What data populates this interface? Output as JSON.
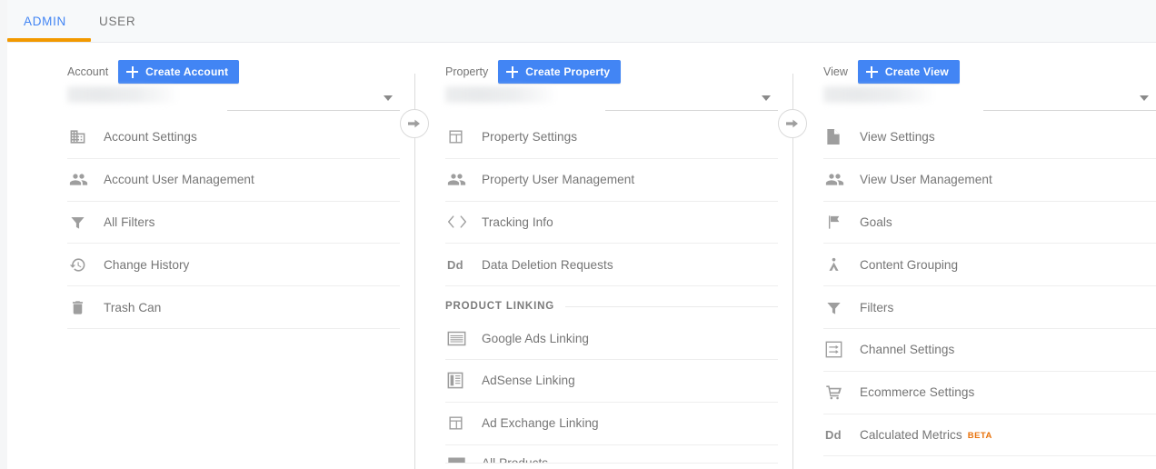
{
  "tabs": [
    {
      "label": "ADMIN",
      "active": true
    },
    {
      "label": "USER",
      "active": false
    }
  ],
  "colors": {
    "accent_blue": "#4285f4",
    "tab_underline_orange": "#f29900",
    "beta_badge_orange": "#e8710a",
    "text_gray": "#757575",
    "icon_gray": "#9e9e9e",
    "divider_gray": "#eeeeee",
    "header_bg": "#f7f9fa"
  },
  "columns": {
    "account": {
      "label": "Account",
      "create_button": "Create Account",
      "selector_value": "",
      "selector_caret": "chevron-down-icon",
      "items": [
        {
          "label": "Account Settings",
          "icon": "building-icon"
        },
        {
          "label": "Account User Management",
          "icon": "people-icon"
        },
        {
          "label": "All Filters",
          "icon": "funnel-icon"
        },
        {
          "label": "Change History",
          "icon": "history-icon"
        },
        {
          "label": "Trash Can",
          "icon": "trash-icon"
        }
      ]
    },
    "property": {
      "label": "Property",
      "create_button": "Create Property",
      "selector_value": "",
      "selector_caret": "chevron-down-icon",
      "items": [
        {
          "label": "Property Settings",
          "icon": "layout-icon"
        },
        {
          "label": "Property User Management",
          "icon": "people-icon"
        },
        {
          "label": "Tracking Info",
          "icon": "code-brackets-icon"
        },
        {
          "label": "Data Deletion Requests",
          "icon": "dd-text-icon"
        }
      ],
      "section": {
        "title": "PRODUCT LINKING"
      },
      "section_items": [
        {
          "label": "Google Ads Linking",
          "icon": "ad-banner-icon"
        },
        {
          "label": "AdSense Linking",
          "icon": "adsense-icon"
        },
        {
          "label": "Ad Exchange Linking",
          "icon": "layout-icon"
        },
        {
          "label": "All Products",
          "icon": "products-icon",
          "clipped": true
        }
      ]
    },
    "view": {
      "label": "View",
      "create_button": "Create View",
      "selector_value": "",
      "selector_caret": "chevron-down-icon",
      "items": [
        {
          "label": "View Settings",
          "icon": "document-icon"
        },
        {
          "label": "View User Management",
          "icon": "people-icon"
        },
        {
          "label": "Goals",
          "icon": "flag-icon"
        },
        {
          "label": "Content Grouping",
          "icon": "grouping-icon"
        },
        {
          "label": "Filters",
          "icon": "funnel-icon"
        },
        {
          "label": "Channel Settings",
          "icon": "channel-icon"
        },
        {
          "label": "Ecommerce Settings",
          "icon": "cart-icon"
        },
        {
          "label": "Calculated Metrics",
          "icon": "dd-text-icon",
          "badge": "BETA"
        }
      ]
    }
  },
  "connectors": [
    {
      "icon": "arrow-right-circle-icon"
    },
    {
      "icon": "arrow-right-circle-icon"
    }
  ]
}
